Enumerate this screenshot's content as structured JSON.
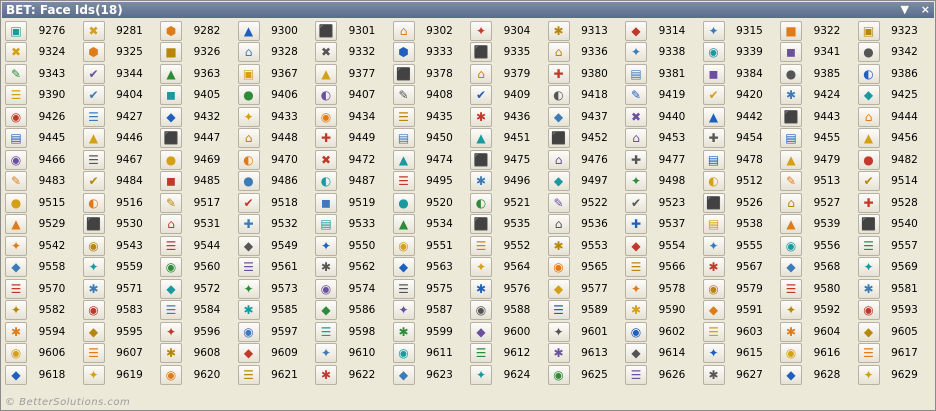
{
  "title": "BET: Face Ids(18)",
  "controls": {
    "dropdown": "▼",
    "close": "×"
  },
  "footer": "© BetterSolutions.com",
  "icon_palette": [
    "#1f5fbf",
    "#2e8b3a",
    "#c0392b",
    "#d4a017",
    "#6b4fa0",
    "#3d7ab8",
    "#e07b1a",
    "#555555",
    "#1a9aa0",
    "#b8860b"
  ],
  "glyph_set": [
    "▦",
    "✎",
    "◉",
    "▲",
    "■",
    "●",
    "◆",
    "✚",
    "✖",
    "✔",
    "☰",
    "⬛",
    "▣",
    "◐",
    "✦",
    "▤",
    "⬢",
    "◼",
    "✱",
    "⌂"
  ],
  "rows": [
    [
      9276,
      9281,
      9282,
      9300,
      9301,
      9302,
      9304,
      9313,
      9314,
      9315,
      9322,
      9323
    ],
    [
      9324,
      9325,
      9326,
      9328,
      9332,
      9333,
      9335,
      9336,
      9338,
      9339,
      9341,
      9342
    ],
    [
      9343,
      9344,
      9363,
      9367,
      9377,
      9378,
      9379,
      9380,
      9381,
      9384,
      9385,
      9386
    ],
    [
      9390,
      9404,
      9405,
      9406,
      9407,
      9408,
      9409,
      9418,
      9419,
      9420,
      9424,
      9425
    ],
    [
      9426,
      9427,
      9432,
      9433,
      9434,
      9435,
      9436,
      9437,
      9440,
      9442,
      9443,
      9444
    ],
    [
      9445,
      9446,
      9447,
      9448,
      9449,
      9450,
      9451,
      9452,
      9453,
      9454,
      9455,
      9456
    ],
    [
      9466,
      9467,
      9469,
      9470,
      9472,
      9474,
      9475,
      9476,
      9477,
      9478,
      9479,
      9482
    ],
    [
      9483,
      9484,
      9485,
      9486,
      9487,
      9495,
      9496,
      9497,
      9498,
      9512,
      9513,
      9514
    ],
    [
      9515,
      9516,
      9517,
      9518,
      9519,
      9520,
      9521,
      9522,
      9523,
      9526,
      9527,
      9528
    ],
    [
      9529,
      9530,
      9531,
      9532,
      9533,
      9534,
      9535,
      9536,
      9537,
      9538,
      9539,
      9540
    ],
    [
      9542,
      9543,
      9544,
      9549,
      9550,
      9551,
      9552,
      9553,
      9554,
      9555,
      9556,
      9557
    ],
    [
      9558,
      9559,
      9560,
      9561,
      9562,
      9563,
      9564,
      9565,
      9566,
      9567,
      9568,
      9569
    ],
    [
      9570,
      9571,
      9572,
      9573,
      9574,
      9575,
      9576,
      9577,
      9578,
      9579,
      9580,
      9581
    ],
    [
      9582,
      9583,
      9584,
      9585,
      9586,
      9587,
      9588,
      9589,
      9590,
      9591,
      9592,
      9593
    ],
    [
      9594,
      9595,
      9596,
      9597,
      9598,
      9599,
      9600,
      9601,
      9602,
      9603,
      9604,
      9605
    ],
    [
      9606,
      9607,
      9608,
      9609,
      9610,
      9611,
      9612,
      9613,
      9614,
      9615,
      9616,
      9617
    ],
    [
      9618,
      9619,
      9620,
      9621,
      9622,
      9623,
      9624,
      9625,
      9626,
      9627,
      9628,
      9629
    ]
  ]
}
